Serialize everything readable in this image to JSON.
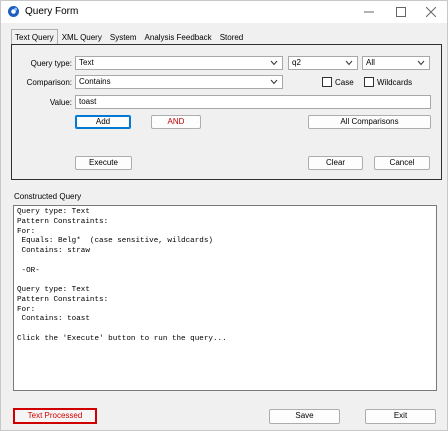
{
  "window": {
    "title": "Query Form"
  },
  "tabs": [
    "Text Query",
    "XML Query",
    "System",
    "Analysis Feedback",
    "Stored"
  ],
  "form": {
    "query_type_label": "Query type:",
    "query_type_value": "Text",
    "query_type_extra": "q2",
    "query_scope": "All",
    "comparison_label": "Comparison:",
    "comparison_value": "Contains",
    "case_label": "Case",
    "case_checked": false,
    "wildcards_label": "Wildcards",
    "wildcards_checked": false,
    "value_label": "Value:",
    "value_text": "toast"
  },
  "buttons": {
    "add": "Add",
    "and": "AND",
    "all_comparisons": "All Comparisons",
    "execute": "Execute",
    "clear": "Clear",
    "cancel": "Cancel",
    "save": "Save",
    "exit": "Exit"
  },
  "constructed_query": {
    "label": "Constructed Query",
    "text": "Query type: Text\nPattern Constraints:\nFor:\n Equals: Belg*  (case sensitive, wildcards)\n Contains: straw\n\n -OR-\n\nQuery type: Text\nPattern Constraints:\nFor:\n Contains: toast\n\nClick the 'Execute' button to run the query..."
  },
  "status": {
    "text": "Text Processed",
    "color": "#d00000"
  },
  "colors": {
    "accent": "#0078d4",
    "app_icon": "#1e5fbf"
  }
}
